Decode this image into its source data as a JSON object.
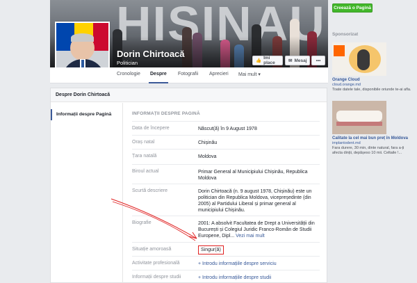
{
  "cover": {
    "ghost_text": "HISINAU"
  },
  "profile": {
    "name": "Dorin Chirtoacă",
    "category": "Politician"
  },
  "cover_buttons": {
    "like_label": "Îmi place",
    "message_label": "Mesaj",
    "more_label": "•••"
  },
  "create_page_label": "Creează o Pagină",
  "tabs": [
    {
      "label": "Cronologie"
    },
    {
      "label": "Despre"
    },
    {
      "label": "Fotografii"
    },
    {
      "label": "Aprecieri"
    },
    {
      "label": "Mai mult ▾"
    }
  ],
  "about": {
    "header": "Despre Dorin Chirtoacă",
    "side_item": "Informații despre Pagină",
    "section_title": "INFORMAȚII DESPRE PAGINĂ",
    "rows": [
      {
        "label": "Data de începere",
        "value": "Născut(ă) în 9 August 1978"
      },
      {
        "label": "Oraș natal",
        "value": "Chișinău"
      },
      {
        "label": "Țara natală",
        "value": "Moldova"
      },
      {
        "label": "Biroul actual",
        "value": "Primar General al Municipiului Chișinău, Republica Moldova"
      },
      {
        "label": "Scurtă descriere",
        "value": "Dorin Chirtoacă (n. 9 august 1978, Chișinău) este un politician din Republica Moldova, vicepreședinte (din 2005) al Partidului Liberal și primar general al municipiului Chișinău."
      },
      {
        "label": "Biografie",
        "value": "2001: A absolvit Facultatea de Drept a Universității din București și Colegiul Juridic Franco-Român de Studii Europene, Dipl...",
        "link": "Vezi mai mult"
      },
      {
        "label": "Situație amoroasă",
        "value": "Singur(ă)"
      },
      {
        "label": "Activitate profesională",
        "link": "+ Introdu informațiile despre serviciu"
      },
      {
        "label": "Informații despre studii",
        "link": "+ Introdu informațiile despre studii"
      }
    ]
  },
  "sidebar": {
    "sponsored_label": "Sponsorizat",
    "ads": [
      {
        "title": "Orange Cloud",
        "link": "cloud.orange.md",
        "desc": "Toate datele tale, disponibile oriunde te-ai afla."
      },
      {
        "title": "Calitate la cel mai bun preț în Moldova",
        "link": "implantodent.md",
        "desc": "Fara durere, 30 min, dinte natural, fara a-ți afecta dinții, depășeso 10 mii. Celtaile !..."
      }
    ]
  },
  "colors": {
    "facebook_blue": "#3b5998",
    "link": "#365899",
    "create_button": "#42b72a",
    "annotation_red": "#e02020"
  }
}
